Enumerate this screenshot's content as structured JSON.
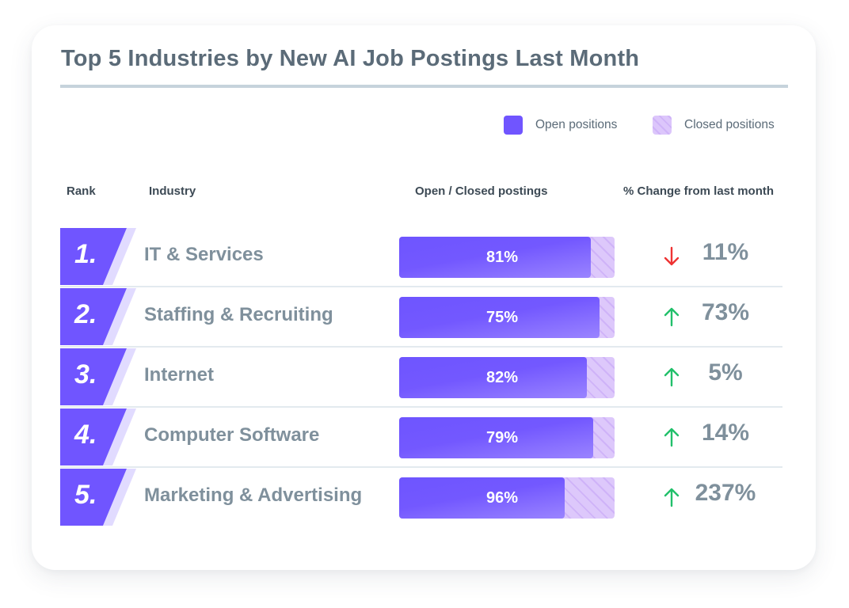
{
  "chart_data": {
    "type": "table",
    "title": "Top 5 Industries by New AI Job Postings Last Month",
    "legend": [
      {
        "label": "Open positions",
        "color": "#7055ff",
        "pattern": "solid"
      },
      {
        "label": "Closed positions",
        "color": "#d6bffa",
        "pattern": "hatched"
      }
    ],
    "legend_position": "top-right",
    "columns": [
      "Rank",
      "Industry",
      "Open / Closed postings",
      "% Change from last month"
    ],
    "rows": [
      {
        "rank": "1.",
        "industry": "IT & Services",
        "open_label": "81%",
        "open_fraction_shown": 0.89,
        "change": "11%",
        "direction": "down"
      },
      {
        "rank": "2.",
        "industry": "Staffing & Recruiting",
        "open_label": "75%",
        "open_fraction_shown": 0.93,
        "change": "73%",
        "direction": "up"
      },
      {
        "rank": "3.",
        "industry": "Internet",
        "open_label": "82%",
        "open_fraction_shown": 0.87,
        "change": "5%",
        "direction": "up"
      },
      {
        "rank": "4.",
        "industry": "Computer Software",
        "open_label": "79%",
        "open_fraction_shown": 0.9,
        "change": "14%",
        "direction": "up"
      },
      {
        "rank": "5.",
        "industry": "Marketing & Advertising",
        "open_label": "96%",
        "open_fraction_shown": 0.77,
        "change": "237%",
        "direction": "up"
      }
    ]
  },
  "colors": {
    "accent": "#7055ff",
    "accent_light": "#e1dbff",
    "up": "#22c06b",
    "down": "#ee3333",
    "text_muted": "#7f909c",
    "title": "#5b6b78"
  }
}
